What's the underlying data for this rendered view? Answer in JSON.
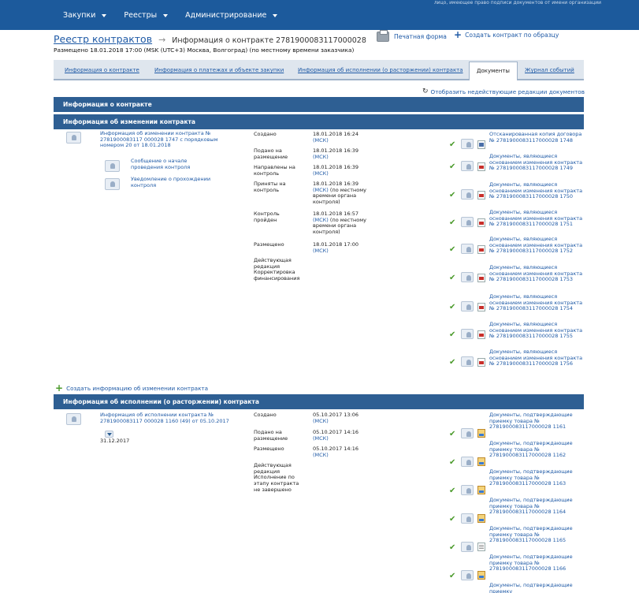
{
  "topbar": {
    "notice": "лицо, имеющее право подписи документов от имени организации",
    "nav": [
      {
        "label": "Закупки"
      },
      {
        "label": "Реестры"
      },
      {
        "label": "Администрирование"
      }
    ]
  },
  "header": {
    "breadcrumb_link": "Реестр контрактов",
    "breadcrumb_current": "Информация о контракте 2781900083117000028",
    "posted": "Размещено 18.01.2018 17:00 (MSK (UTC+3) Москва, Волгоград) (по местному времени заказчика)",
    "print_label": "Печатная форма",
    "create_label": "Создать контракт по образцу"
  },
  "tabs": [
    {
      "label": "Информация о контракте",
      "active": false
    },
    {
      "label": "Информация о платежах и объекте закупки",
      "active": false
    },
    {
      "label": "Информация об исполнении (о расторжении) контракта",
      "active": false
    },
    {
      "label": "Документы",
      "active": true
    },
    {
      "label": "Журнал событий",
      "active": false
    }
  ],
  "show_inactive_label": "Отобразить недействующие редакции документов",
  "sections": {
    "contract_info": "Информация о контракте",
    "change_info": "Информация об изменении контракта",
    "execution_info": "Информация об исполнении (о расторжении) контракта"
  },
  "change_block": {
    "title": "Информация об изменении контракта № 2781900083117 000028 1747 с порядковым номером 20 от 18.01.2018",
    "sub_links": [
      "Сообщение о начале проведения контроля",
      "Уведомление о прохождении контроля"
    ],
    "events": [
      {
        "label": "Создано",
        "date": "18.01.2018 16:24",
        "tz": "(МСК)",
        "extra": ""
      },
      {
        "label": "Подано на размещение",
        "date": "18.01.2018 16:39",
        "tz": "(МСК)",
        "extra": ""
      },
      {
        "label": "Направлены на контроль",
        "date": "18.01.2018 16:39",
        "tz": "(МСК)",
        "extra": ""
      },
      {
        "label": "Приняты на контроль",
        "date": "18.01.2018 16:39",
        "tz": "(МСК)",
        "extra": "(по местному времени органа контроля)"
      },
      {
        "label": "Контроль пройден",
        "date": "18.01.2018 16:57",
        "tz": "(МСК)",
        "extra": "(по местному времени органа контроля)"
      },
      {
        "label": "Размещено",
        "date": "18.01.2018 17:00",
        "tz": "(МСК)",
        "extra": ""
      }
    ],
    "status": "Действующая редакция Корректировка финансирования",
    "documents": [
      {
        "text": "Отсканированная копия договора № 2781900083117000028 1748",
        "icon": "scan"
      },
      {
        "text": "Документы, являющиеся основанием изменения контракта № 2781900083117000028 1749",
        "icon": "pdf"
      },
      {
        "text": "Документы, являющиеся основанием изменения контракта № 2781900083117000028 1750",
        "icon": "pdf"
      },
      {
        "text": "Документы, являющиеся основанием изменения контракта № 2781900083117000028 1751",
        "icon": "pdf"
      },
      {
        "text": "Документы, являющиеся основанием изменения контракта № 2781900083117000028 1752",
        "icon": "pdf"
      },
      {
        "text": "Документы, являющиеся основанием изменения контракта № 2781900083117000028 1753",
        "icon": "pdf"
      },
      {
        "text": "Документы, являющиеся основанием изменения контракта № 2781900083117000028 1754",
        "icon": "pdf"
      },
      {
        "text": "Документы, являющиеся основанием изменения контракта № 2781900083117000028 1755",
        "icon": "pdf"
      },
      {
        "text": "Документы, являющиеся основанием изменения контракта № 2781900083117000028 1756",
        "icon": "pdf"
      }
    ]
  },
  "add_change_label": "Создать информацию об изменении контракта",
  "execution_block": {
    "title": "Информация об исполнении контракта № 2781900083117 000028 1160 (49) от 05.10.2017",
    "end_date": "31.12.2017",
    "events": [
      {
        "label": "Создано",
        "date": "05.10.2017 13:06",
        "tz": "(МСК)"
      },
      {
        "label": "Подано на размещение",
        "date": "05.10.2017 14:16",
        "tz": "(МСК)"
      },
      {
        "label": "Размещено",
        "date": "05.10.2017 14:16",
        "tz": "(МСК)"
      }
    ],
    "status": "Действующая редакция Исполнение по этапу контракта не завершено",
    "documents": [
      {
        "text": "Документы, подтверждающие приемку товара № 2781900083117000028 1161",
        "icon": "img"
      },
      {
        "text": "Документы, подтверждающие приемку товара № 2781900083117000028 1162",
        "icon": "img"
      },
      {
        "text": "Документы, подтверждающие приемку товара № 2781900083117000028 1163",
        "icon": "img"
      },
      {
        "text": "Документы, подтверждающие приемку товара № 2781900083117000028 1164",
        "icon": "img"
      },
      {
        "text": "Документы, подтверждающие приемку товара № 2781900083117000028 1165",
        "icon": "txt"
      },
      {
        "text": "Документы, подтверждающие приемку товара № 2781900083117000028 1166",
        "icon": "img"
      },
      {
        "text": "Документы, подтверждающие приемку",
        "icon": "img"
      }
    ]
  }
}
